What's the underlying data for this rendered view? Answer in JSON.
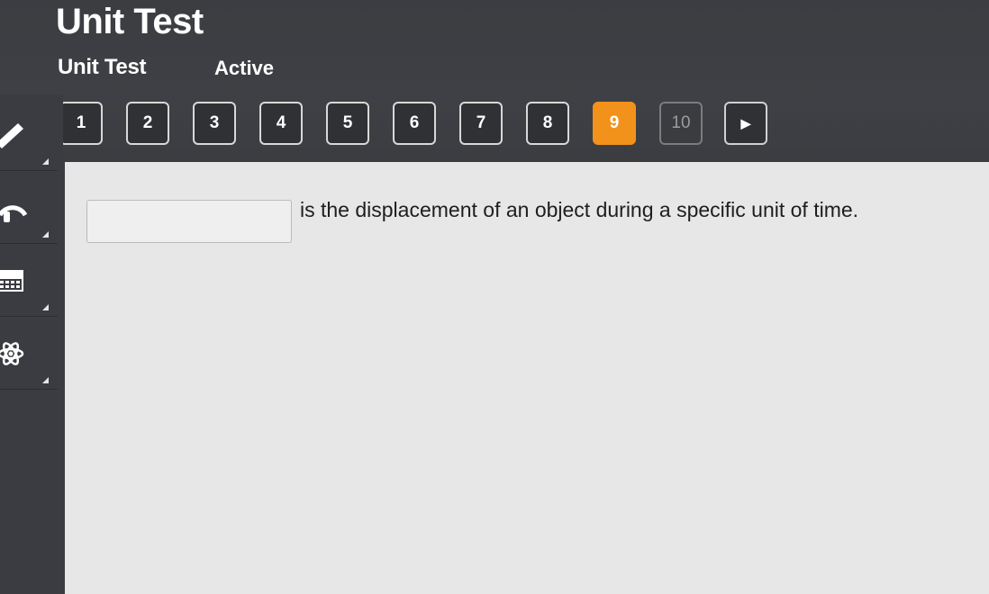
{
  "header": {
    "title": "Unit Test",
    "subtitle": "Unit Test",
    "status": "Active"
  },
  "question_nav": {
    "items": [
      "1",
      "2",
      "3",
      "4",
      "5",
      "6",
      "7",
      "8",
      "9",
      "10"
    ],
    "current": "9",
    "next_label": "▶"
  },
  "sidebar": {
    "tools": [
      "pencil-icon",
      "headphones-icon",
      "calculator-icon",
      "atom-icon"
    ]
  },
  "question": {
    "text": "is the displacement of an object during a specific unit of time.",
    "answer_value": ""
  },
  "colors": {
    "accent": "#f2921a",
    "background": "#3a3c41",
    "content": "#e6e7e6"
  }
}
